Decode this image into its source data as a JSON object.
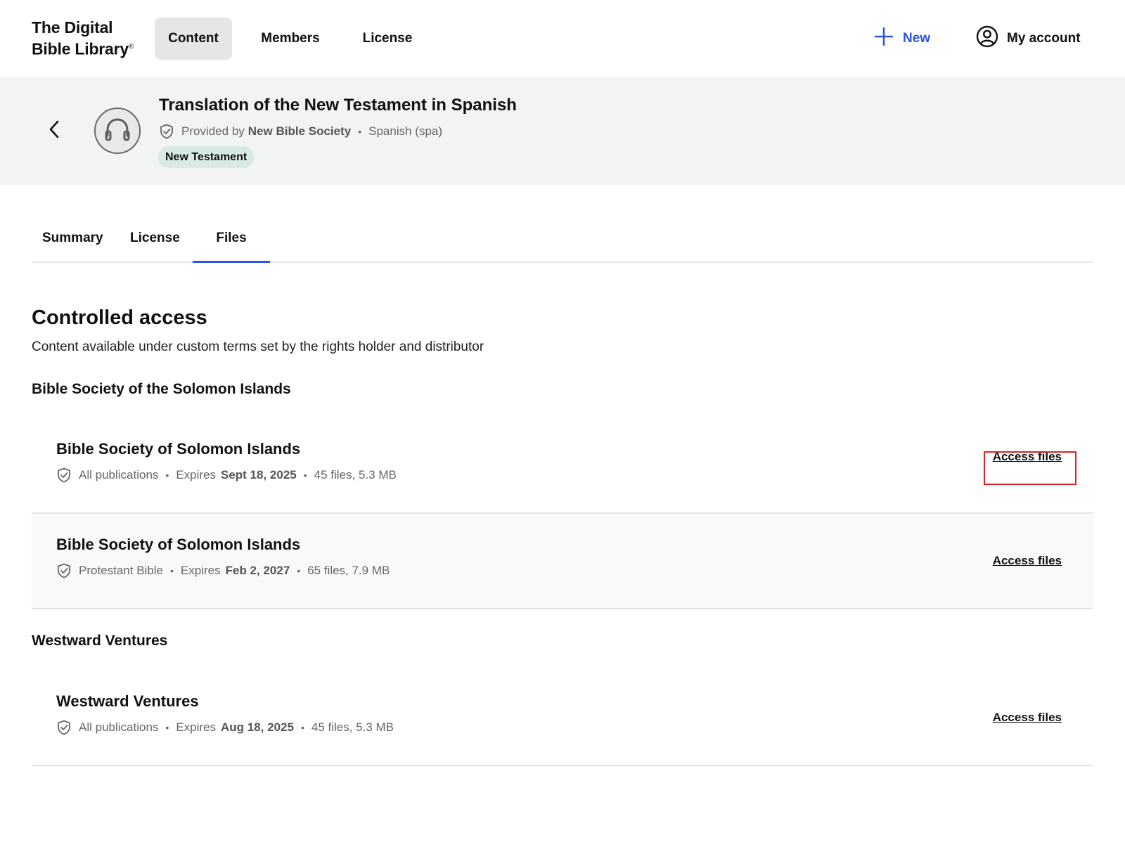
{
  "app": {
    "logo_line1": "The Digital",
    "logo_line2": "Bible Library",
    "logo_mark": "®"
  },
  "topnav": {
    "items": [
      {
        "label": "Content",
        "active": true
      },
      {
        "label": "Members",
        "active": false
      },
      {
        "label": "License",
        "active": false
      }
    ],
    "new_label": "New",
    "account_label": "My account"
  },
  "header": {
    "title": "Translation of the New Testament in Spanish",
    "provided_by_prefix": "Provided by",
    "provider": "New Bible Society",
    "language": "Spanish (spa)",
    "badge": "New Testament",
    "media_icon": "headphones-icon"
  },
  "tabs": [
    {
      "label": "Summary",
      "active": false
    },
    {
      "label": "License",
      "active": false
    },
    {
      "label": "Files",
      "active": true
    }
  ],
  "section": {
    "title": "Controlled access",
    "subtitle": "Content available under custom terms set by the rights holder and distributor"
  },
  "groups": [
    {
      "title": "Bible Society of the Solomon Islands",
      "entries": [
        {
          "name": "Bible Society of Solomon Islands",
          "scope": "All publications",
          "expires_label": "Expires",
          "expires": "Sept 18, 2025",
          "files": "45 files, 5.3 MB",
          "action": "Access files",
          "highlighted": true
        },
        {
          "name": "Bible Society of Solomon Islands",
          "scope": "Protestant Bible",
          "expires_label": "Expires",
          "expires": "Feb 2, 2027",
          "files": "65 files, 7.9 MB",
          "action": "Access files",
          "highlighted": false
        }
      ]
    },
    {
      "title": "Westward Ventures",
      "entries": [
        {
          "name": "Westward Ventures",
          "scope": "All publications",
          "expires_label": "Expires",
          "expires": "Aug 18, 2025",
          "files": "45 files, 5.3 MB",
          "action": "Access files",
          "highlighted": false
        }
      ]
    }
  ],
  "colors": {
    "accent": "#2f54e6",
    "band_bg": "#f1f3f4",
    "badge_bg": "#d8e9e6",
    "highlight": "#e02020"
  }
}
